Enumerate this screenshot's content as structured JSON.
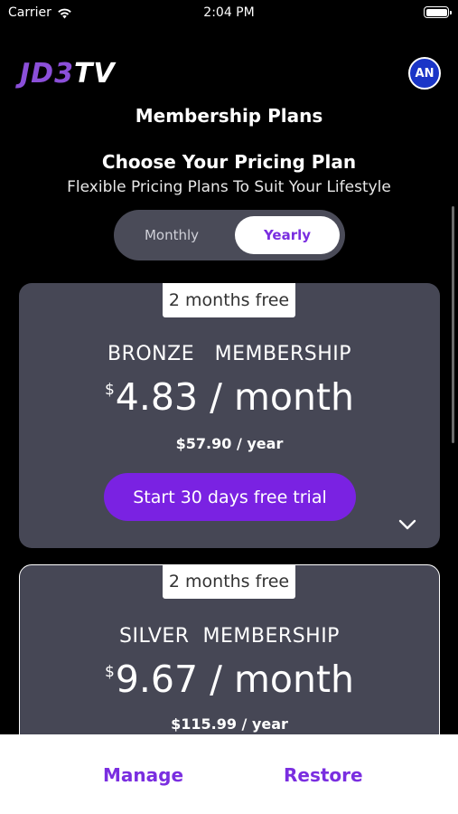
{
  "status_bar": {
    "carrier": "Carrier",
    "time": "2:04 PM"
  },
  "header": {
    "logo_part1": "JD3",
    "logo_part2": "TV",
    "avatar_initials": "AN"
  },
  "page_title": "Membership Plans",
  "heading": "Choose Your Pricing Plan",
  "subheading": "Flexible Pricing Plans To Suit Your Lifestyle",
  "billing_toggle": {
    "options": [
      "Monthly",
      "Yearly"
    ],
    "selected": "Yearly"
  },
  "plans": [
    {
      "badge": "2 months free",
      "name": "BRONZE   MEMBERSHIP",
      "currency": "$",
      "price_monthly": "4.83 / month",
      "price_yearly": "$57.90 / year",
      "cta": "Start 30 days free trial"
    },
    {
      "badge": "2 months free",
      "name": "SILVER  MEMBERSHIP",
      "currency": "$",
      "price_monthly": "9.67 / month",
      "price_yearly": "$115.99 / year"
    }
  ],
  "bottom_bar": {
    "manage": "Manage",
    "restore": "Restore"
  },
  "colors": {
    "accent": "#7a22e2",
    "card": "#464755",
    "avatar": "#1a35c7"
  }
}
